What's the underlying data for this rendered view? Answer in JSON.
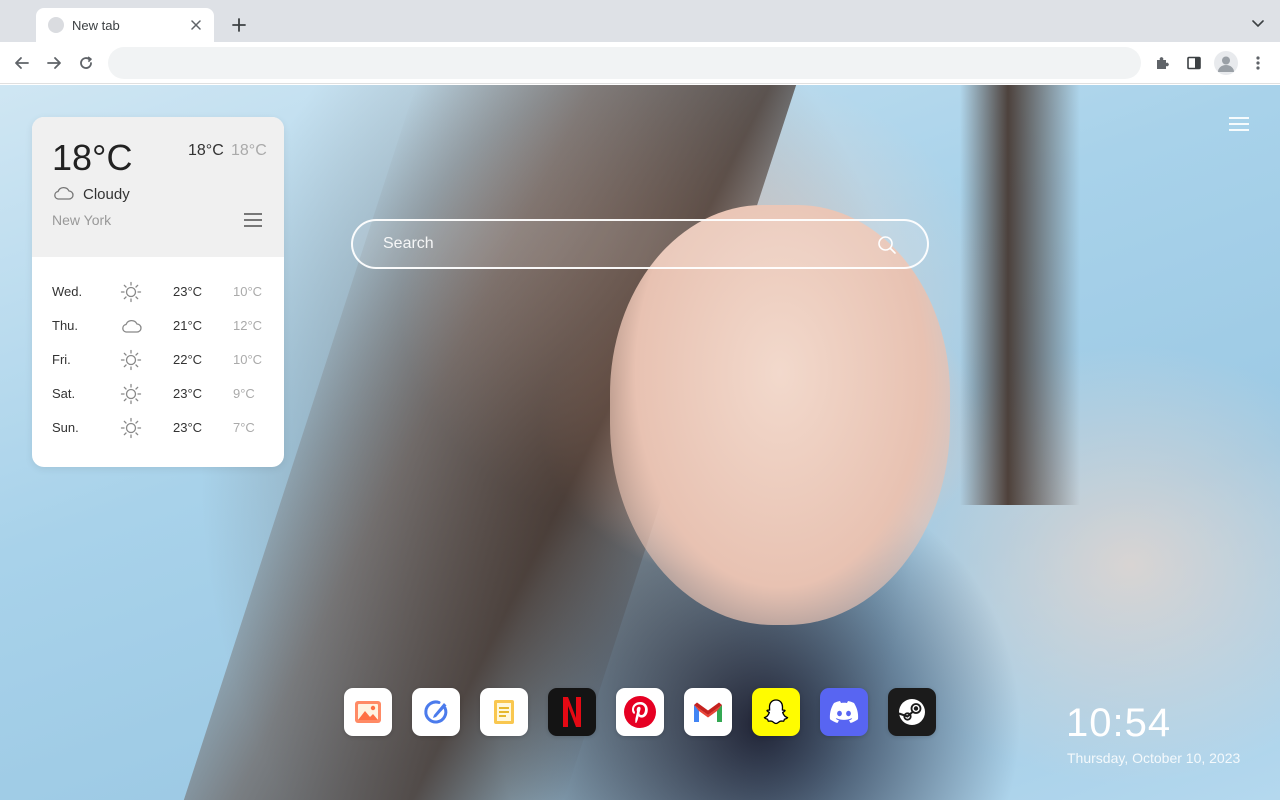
{
  "browser": {
    "tab_title": "New tab",
    "address_value": "",
    "address_placeholder": "",
    "icons": [
      "close-icon",
      "plus-icon",
      "chevron-down-icon",
      "back-arrow-icon",
      "forward-arrow-icon",
      "reload-icon",
      "puzzle-icon",
      "side-panel-icon",
      "profile-icon",
      "more-vert-icon"
    ]
  },
  "weather": {
    "current_temp": "18°C",
    "high": "18°C",
    "low": "18°C",
    "condition": "Cloudy",
    "city": "New York",
    "forecast": [
      {
        "day": "Wed.",
        "icon": "sun-icon",
        "high": "23°C",
        "low": "10°C"
      },
      {
        "day": "Thu.",
        "icon": "cloud-icon",
        "high": "21°C",
        "low": "12°C"
      },
      {
        "day": "Fri.",
        "icon": "sun-icon",
        "high": "22°C",
        "low": "10°C"
      },
      {
        "day": "Sat.",
        "icon": "sun-icon",
        "high": "23°C",
        "low": "9°C"
      },
      {
        "day": "Sun.",
        "icon": "sun-icon",
        "high": "23°C",
        "low": "7°C"
      }
    ]
  },
  "search": {
    "placeholder": "Search"
  },
  "dock": [
    {
      "name": "gallery",
      "icon": "picture-icon",
      "color": "#ffffff"
    },
    {
      "name": "check",
      "icon": "check-pen-icon",
      "color": "#ffffff"
    },
    {
      "name": "notes",
      "icon": "notes-icon",
      "color": "#ffffff"
    },
    {
      "name": "netflix",
      "icon": "netflix-icon",
      "color": "#141414"
    },
    {
      "name": "pinterest",
      "icon": "pinterest-icon",
      "color": "#ffffff"
    },
    {
      "name": "gmail",
      "icon": "gmail-icon",
      "color": "#ffffff"
    },
    {
      "name": "snapchat",
      "icon": "snapchat-icon",
      "color": "#fffc00"
    },
    {
      "name": "discord",
      "icon": "discord-icon",
      "color": "#5865f2"
    },
    {
      "name": "steam",
      "icon": "steam-icon",
      "color": "#1b1b1b"
    }
  ],
  "clock": {
    "time": "10:54",
    "date": "Thursday, October 10, 2023"
  }
}
